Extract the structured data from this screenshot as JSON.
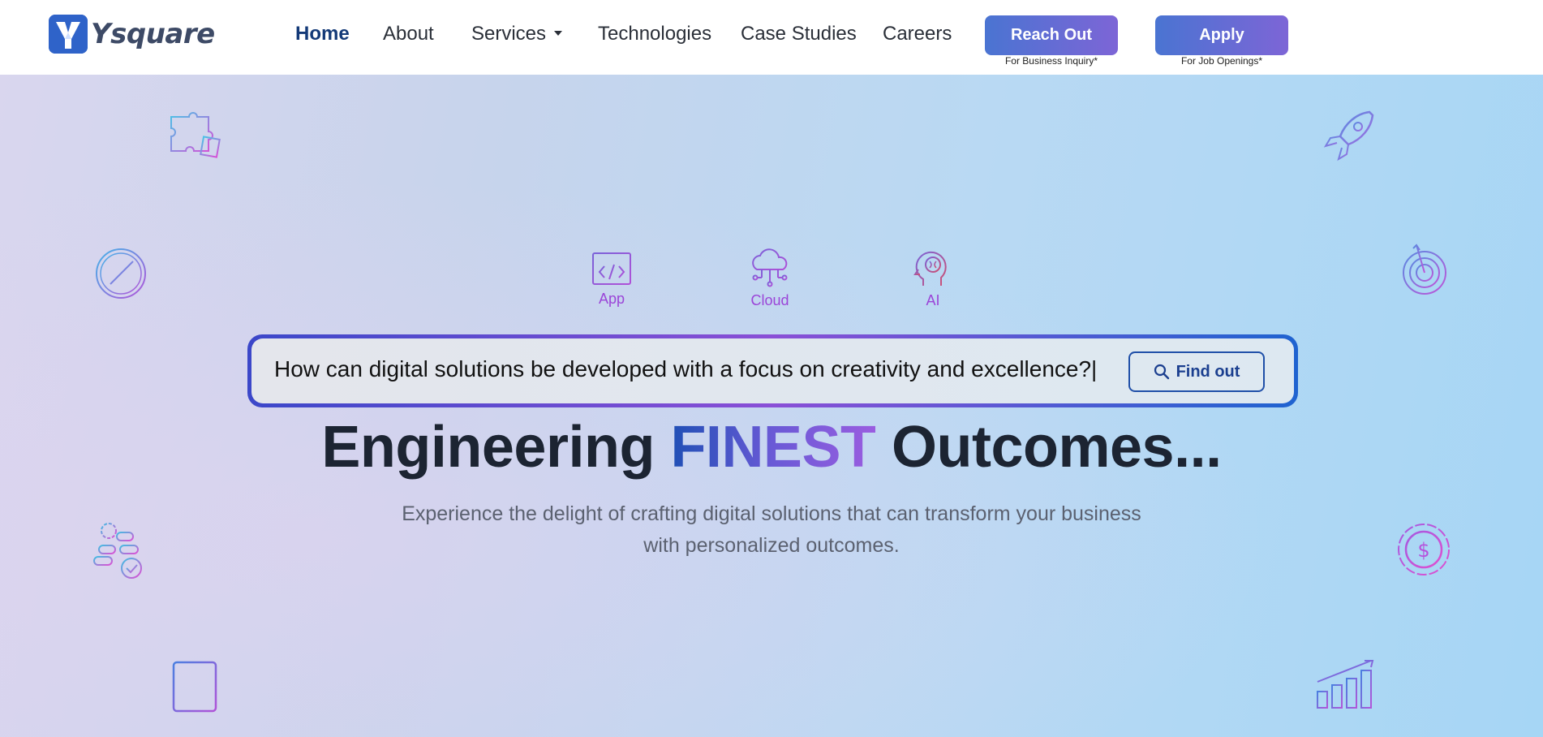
{
  "logo": {
    "text": "Ysquare",
    "icon": "ysquare-logo-icon"
  },
  "nav": {
    "items": [
      {
        "label": "Home",
        "active": true
      },
      {
        "label": "About"
      },
      {
        "label": "Services",
        "dropdown": true
      },
      {
        "label": "Technologies"
      },
      {
        "label": "Case Studies"
      },
      {
        "label": "Careers"
      }
    ]
  },
  "cta": {
    "reach_out": {
      "label": "Reach Out",
      "sub": "For Business Inquiry*"
    },
    "apply": {
      "label": "Apply",
      "sub": "For Job Openings*"
    }
  },
  "services": [
    {
      "label": "App",
      "icon": "app-code-icon"
    },
    {
      "label": "Cloud",
      "icon": "cloud-network-icon"
    },
    {
      "label": "AI",
      "icon": "ai-brain-icon"
    }
  ],
  "search": {
    "query": "How can digital solutions be developed with a focus on creativity and excellence?|",
    "button_label": "Find out",
    "button_icon": "search-icon"
  },
  "hero": {
    "headline_prefix": "Engineering",
    "headline_accent": "FINEST",
    "headline_suffix": "Outcomes...",
    "subtext": "Experience the delight of crafting digital solutions that can transform your business with personalized outcomes."
  },
  "decorations": [
    "puzzle-icon",
    "compass-icon",
    "workflow-gears-icon",
    "scroll-document-icon",
    "rocket-icon",
    "target-icon",
    "dollar-coin-icon",
    "growth-chart-icon"
  ],
  "colors": {
    "primary": "#1f4fb5",
    "accent_purple": "#7d65d6",
    "nav_active": "#143a78"
  }
}
